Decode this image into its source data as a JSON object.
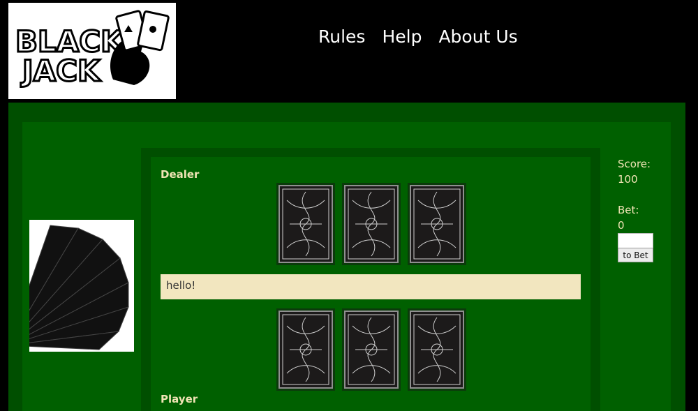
{
  "header": {
    "logo_text": "BLACK JACK",
    "nav": [
      {
        "label": "Rules"
      },
      {
        "label": "Help"
      },
      {
        "label": "About Us"
      }
    ]
  },
  "table": {
    "dealer_label": "Dealer",
    "player_label": "Player",
    "message": "hello!",
    "dealer_cards": 3,
    "player_cards": 3
  },
  "side": {
    "score_label": "Score:",
    "score_value": "100",
    "bet_label": "Bet:",
    "bet_value": "0",
    "bet_input_value": "",
    "bet_button_label": "to Bet"
  },
  "colors": {
    "outer": "#004f00",
    "table": "#006000",
    "label": "#f0e4b4",
    "message_bg": "#f2e6bf"
  },
  "icons": {
    "logo": "blackjack-logo",
    "fan": "card-fan-image",
    "card_back": "ornate-card-back"
  }
}
